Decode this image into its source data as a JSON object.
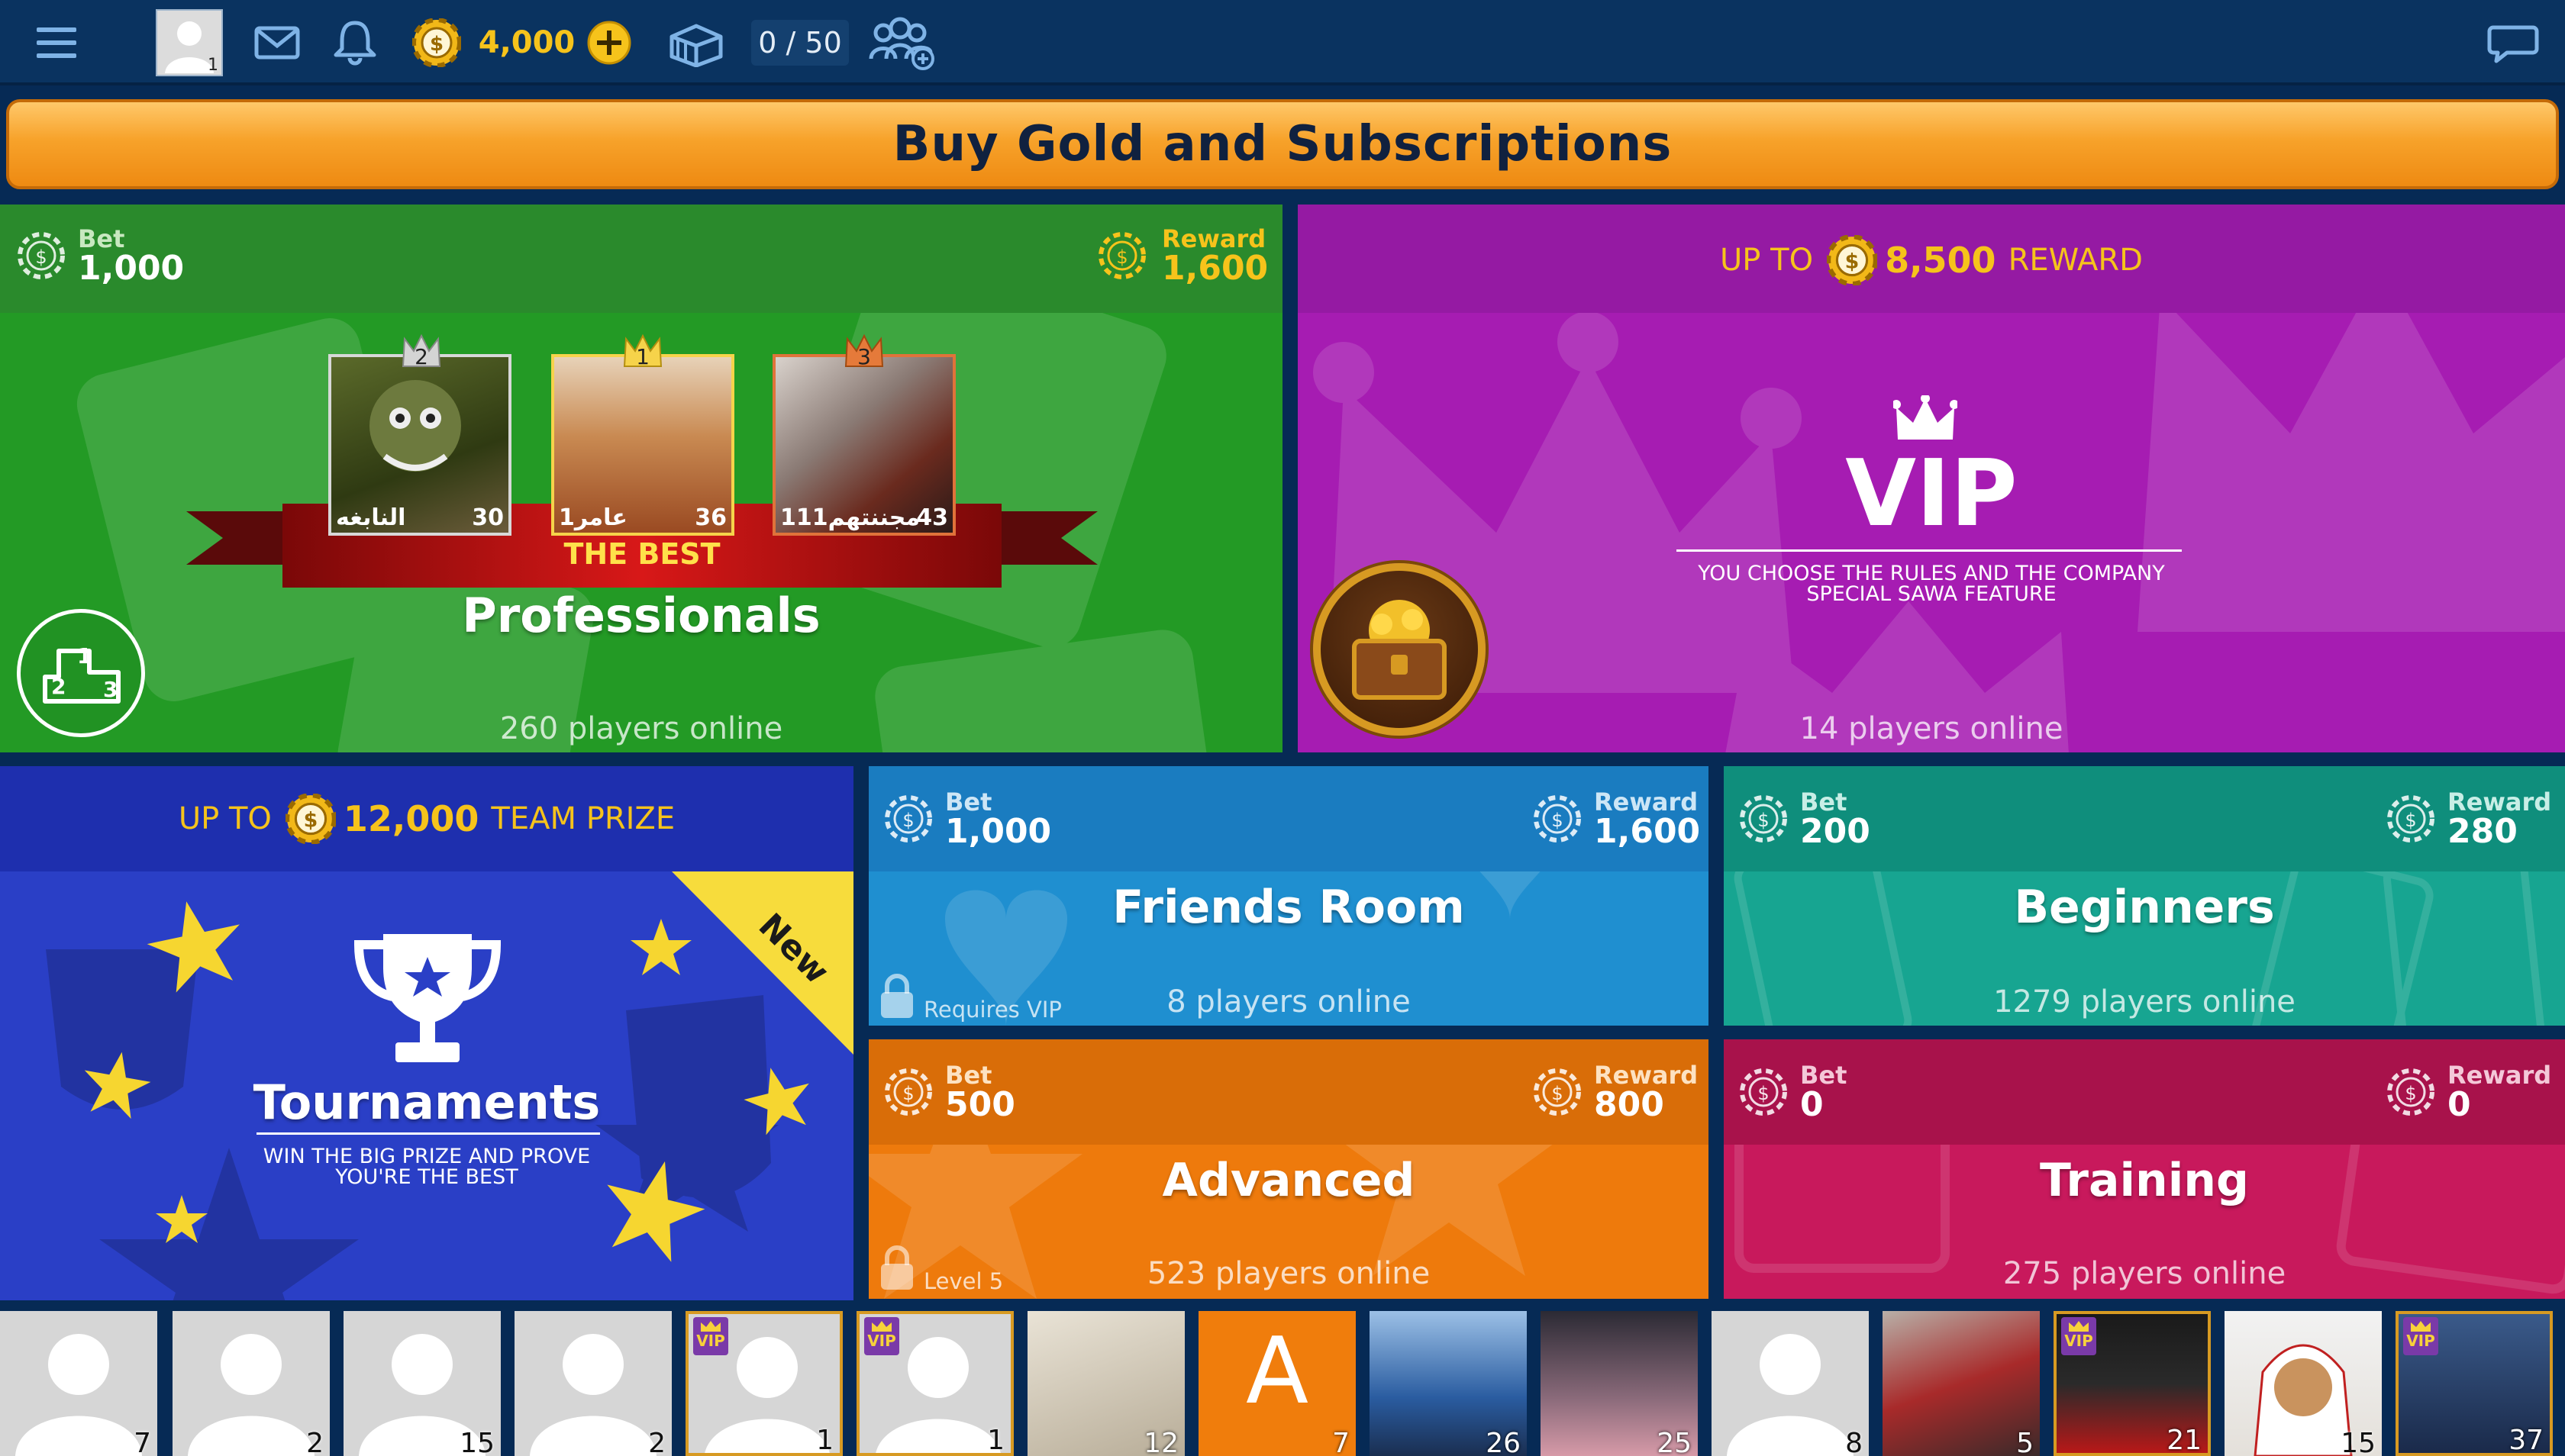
{
  "topbar": {
    "avatar_badge": "1",
    "coins": "4,000",
    "capacity": "0 / 50"
  },
  "banner": {
    "label": "Buy Gold and Subscriptions"
  },
  "professionals": {
    "bet_label": "Bet",
    "bet_value": "1,000",
    "reward_label": "Reward",
    "reward_value": "1,600",
    "leaders": [
      {
        "rank": "2",
        "name": "النابغه",
        "score": "30"
      },
      {
        "rank": "1",
        "name": "عامر1",
        "score": "36"
      },
      {
        "rank": "3",
        "name": "111مجننتهم",
        "score": "43"
      }
    ],
    "ribbon": "THE BEST",
    "title": "Professionals",
    "online": "260 players online",
    "podium_digits": [
      "1",
      "2",
      "3"
    ]
  },
  "vip": {
    "up_to": "UP TO",
    "amount": "8,500",
    "reward": "REWARD",
    "title": "VIP",
    "line1": "YOU CHOOSE THE RULES AND THE COMPANY",
    "line2": "SPECIAL SAWA FEATURE",
    "online": "14 players online"
  },
  "tournaments": {
    "up_to": "UP TO",
    "amount": "12,000",
    "prize": "TEAM PRIZE",
    "new_tag": "New",
    "title": "Tournaments",
    "line1": "WIN THE BIG PRIZE AND PROVE",
    "line2": "YOU'RE THE BEST"
  },
  "friends": {
    "bet_label": "Bet",
    "bet_value": "1,000",
    "reward_label": "Reward",
    "reward_value": "1,600",
    "title": "Friends Room",
    "online": "8 players online",
    "lock_label": "Requires VIP"
  },
  "beginners": {
    "bet_label": "Bet",
    "bet_value": "200",
    "reward_label": "Reward",
    "reward_value": "280",
    "title": "Beginners",
    "online": "1279 players online"
  },
  "advanced": {
    "bet_label": "Bet",
    "bet_value": "500",
    "reward_label": "Reward",
    "reward_value": "800",
    "title": "Advanced",
    "online": "523 players online",
    "lock_label": "Level 5"
  },
  "training": {
    "bet_label": "Bet",
    "bet_value": "0",
    "reward_label": "Reward",
    "reward_value": "0",
    "title": "Training",
    "online": "275 players online"
  },
  "players": [
    {
      "num": "7",
      "vip": false,
      "kind": "default"
    },
    {
      "num": "2",
      "vip": false,
      "kind": "default"
    },
    {
      "num": "15",
      "vip": false,
      "kind": "default"
    },
    {
      "num": "2",
      "vip": false,
      "kind": "default"
    },
    {
      "num": "1",
      "vip": true,
      "kind": "default"
    },
    {
      "num": "1",
      "vip": true,
      "kind": "default"
    },
    {
      "num": "12",
      "vip": false,
      "kind": "photo-paper"
    },
    {
      "num": "7",
      "vip": false,
      "kind": "letter",
      "letter": "A"
    },
    {
      "num": "26",
      "vip": false,
      "kind": "photo-blue"
    },
    {
      "num": "25",
      "vip": false,
      "kind": "photo-dark"
    },
    {
      "num": "8",
      "vip": false,
      "kind": "default"
    },
    {
      "num": "5",
      "vip": false,
      "kind": "photo-red"
    },
    {
      "num": "21",
      "vip": true,
      "kind": "photo-black"
    },
    {
      "num": "15",
      "vip": false,
      "kind": "photo-white"
    },
    {
      "num": "37",
      "vip": true,
      "kind": "photo-night"
    }
  ],
  "vip_tag": "VIP"
}
